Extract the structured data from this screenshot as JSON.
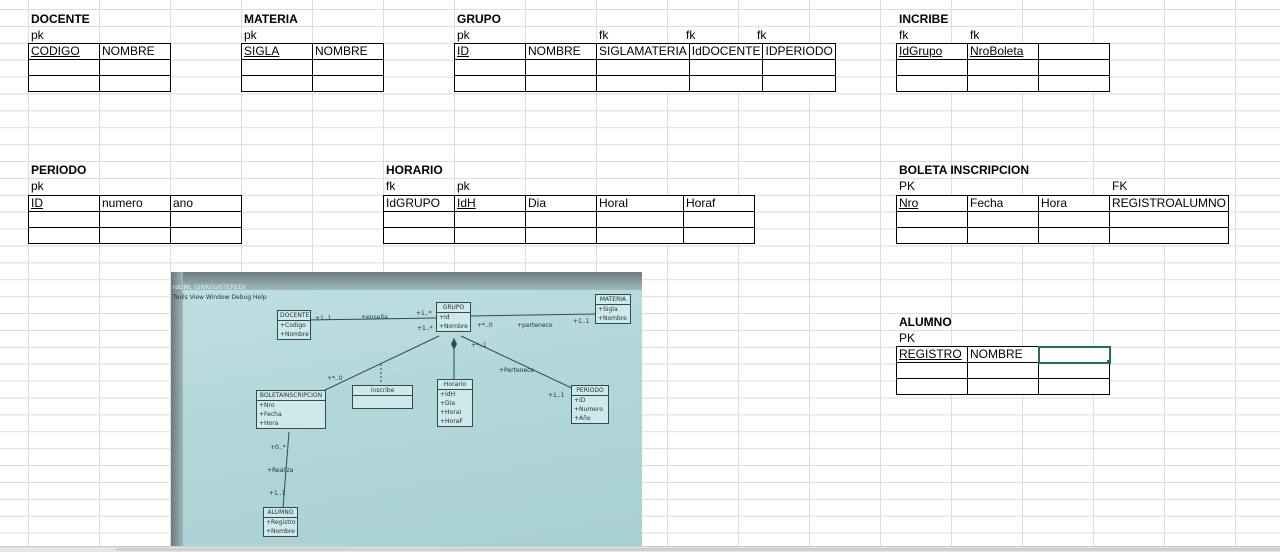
{
  "tables": {
    "docente": {
      "title": "DOCENTE",
      "keys": [
        "pk",
        ""
      ],
      "columns": [
        "CODIGO",
        "NOMBRE"
      ]
    },
    "materia": {
      "title": "MATERIA",
      "keys": [
        "pk",
        ""
      ],
      "columns": [
        "SIGLA",
        "NOMBRE"
      ]
    },
    "grupo": {
      "title": "GRUPO",
      "keys": [
        "pk",
        "",
        "fk",
        "fk",
        "fk"
      ],
      "columns": [
        "ID",
        "NOMBRE",
        "SIGLAMATERIA",
        "IdDOCENTE",
        "IDPERIODO"
      ]
    },
    "incribe": {
      "title": "INCRIBE",
      "keys": [
        "fk",
        "fk",
        ""
      ],
      "columns": [
        "IdGrupo",
        "NroBoleta",
        ""
      ]
    },
    "periodo": {
      "title": "PERIODO",
      "keys": [
        "pk",
        "",
        ""
      ],
      "columns": [
        "ID",
        "numero",
        "ano"
      ]
    },
    "horario": {
      "title": "HORARIO",
      "keys": [
        "fk",
        "pk",
        "",
        "",
        ""
      ],
      "columns": [
        "IdGRUPO",
        "IdH",
        "Dia",
        "HoraI",
        "Horaf"
      ]
    },
    "boleta": {
      "title": "BOLETA INSCRIPCION",
      "keys": [
        "PK",
        "",
        "",
        "FK"
      ],
      "columns": [
        "Nro",
        "Fecha",
        "Hora",
        "REGISTROALUMNO"
      ]
    },
    "alumno": {
      "title": "ALUMNO",
      "keys": [
        "PK",
        "",
        ""
      ],
      "columns": [
        "REGISTRO",
        "NOMBRE",
        ""
      ]
    }
  },
  "photo": {
    "titlebar": "roUML (UNREGISTERED)",
    "menu": "Tools   View   Window   Debug   Help",
    "classes": {
      "docente": {
        "name": "DOCENTE",
        "attrs": [
          "+Codigo",
          "+Nombre"
        ]
      },
      "grupo": {
        "name": "GRUPO",
        "attrs": [
          "+Id",
          "+Nombre"
        ]
      },
      "materia": {
        "name": "MATERIA",
        "attrs": [
          "+Sigla",
          "+Nombre"
        ]
      },
      "boleta": {
        "name": "BOLETAINSCRIPCION",
        "attrs": [
          "+Nro",
          "+Fecha",
          "+Hora"
        ]
      },
      "inscribe": {
        "name": "inscribe",
        "attrs": []
      },
      "horario": {
        "name": "Horario",
        "attrs": [
          "+IdH",
          "+Dia",
          "+HoraI",
          "+HoraF"
        ]
      },
      "periodo": {
        "name": "PERIODO",
        "attrs": [
          "+ID",
          "+Numero",
          "+Año"
        ]
      },
      "alumno": {
        "name": "ALUMNO",
        "attrs": [
          "+Registro",
          "+Nombre"
        ]
      }
    },
    "labels": {
      "ensena": "+enseña",
      "m11a": "+1..1",
      "m1sa": "+1..*",
      "m1sb": "+1..*",
      "m0": "+*..0",
      "pertenece": "+pertenece",
      "m11b": "+1..1",
      "m1b": "+*..1",
      "pertenece2": "+Pertenece",
      "m11c": "+1..1",
      "m0b": "+*..0",
      "m0c": "+0..*",
      "realiza": "+Realiza",
      "m12": "+1..1"
    }
  }
}
